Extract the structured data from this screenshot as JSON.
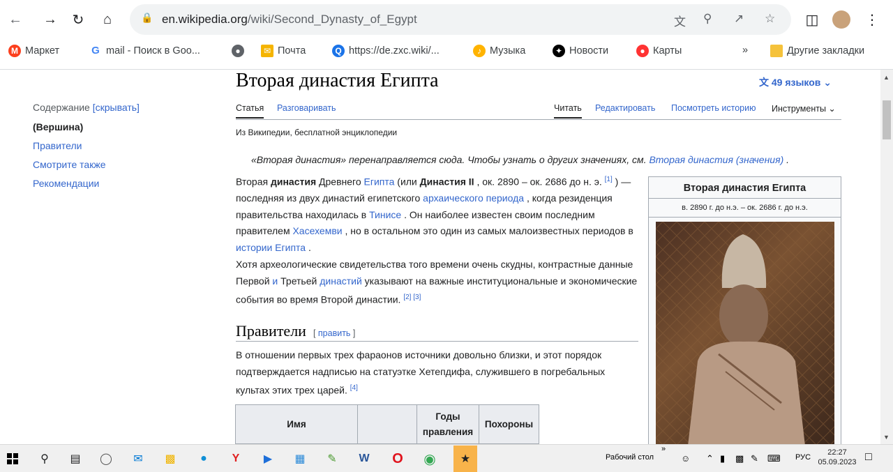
{
  "browser": {
    "url_domain": "en.wikipedia.org",
    "url_path": "/wiki/Second_Dynasty_of_Egypt"
  },
  "bookmarks": [
    {
      "label": "Маркет",
      "icon": "yandex-market-icon",
      "color": "#fc3f1d"
    },
    {
      "label": "mail - Поиск в Goo...",
      "icon": "google-icon",
      "color": "#4285f4"
    },
    {
      "label": "",
      "icon": "globe-icon",
      "color": "#5f6368"
    },
    {
      "label": "Почта",
      "icon": "mail-icon",
      "color": "#f5b400"
    },
    {
      "label": "https://de.zxc.wiki/...",
      "icon": "zxc-icon",
      "color": "#1a73e8"
    },
    {
      "label": "Музыка",
      "icon": "music-icon",
      "color": "#ffb300"
    },
    {
      "label": "Новости",
      "icon": "news-icon",
      "color": "#000000"
    },
    {
      "label": "Карты",
      "icon": "maps-icon",
      "color": "#ff3333"
    }
  ],
  "bookmarks_more": "»",
  "bookmarks_other": "Другие закладки",
  "toc": {
    "header": "Содержание",
    "toggle": "[скрывать]",
    "items": [
      "(Вершина)",
      "Правители",
      "Смотрите также",
      "Рекомендации"
    ]
  },
  "article": {
    "title": "Вторая династия Египта",
    "languages": "49 языков",
    "tabs_left": [
      "Статья",
      "Разговаривать"
    ],
    "tabs_right": [
      "Читать",
      "Редактировать",
      "Посмотреть историю",
      "Инструменты"
    ],
    "from": "Из Википедии, бесплатной энциклопедии",
    "hatnote": "«Вторая династия» перенаправляется сюда. Чтобы узнать о других значениях, см.",
    "hatnote_link": "Вторая династия (значения)",
    "section_title": "Правители",
    "section_edit": "править",
    "table_headers": [
      "Имя",
      "",
      "Годы правления",
      "Похороны"
    ]
  },
  "infobox": {
    "title": "Вторая династия Египта",
    "subtitle": "в. 2890 г. до н.э. – ок. 2686 г. до н.э."
  },
  "taskbar": {
    "desktop_label": "Рабочий стол",
    "lang": "РУС",
    "time": "22:27",
    "date": "05.09.2023"
  }
}
